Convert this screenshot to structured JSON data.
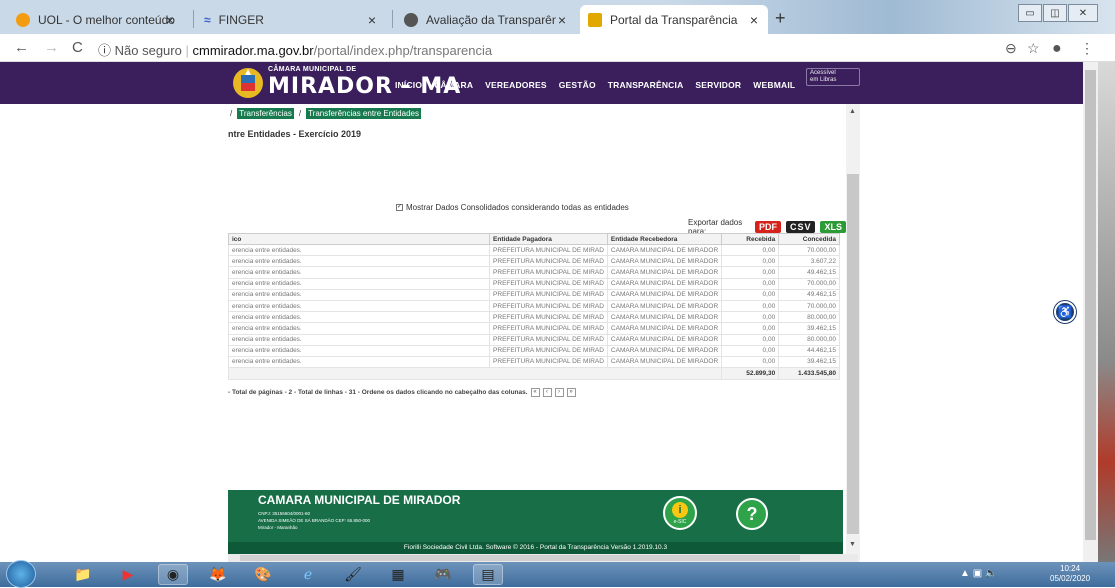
{
  "browser": {
    "tabs": [
      {
        "label": "UOL - O melhor conteúdo",
        "icon_color": "#f39c12"
      },
      {
        "label": "FINGER",
        "icon_color": "#3a5fcd"
      },
      {
        "label": "Avaliação da Transparência dos",
        "icon_color": "#555555"
      },
      {
        "label": "Portal da Transparência",
        "icon_color": "#e0a800",
        "active": true
      }
    ],
    "url_prefix": "Não seguro",
    "url_domain": "cmmirador.ma.gov.br",
    "url_path": "/portal/index.php/transparencia"
  },
  "site": {
    "logo_small": "CÂMARA MUNICIPAL DE",
    "logo_big": "MIRADOR - MA",
    "menu": [
      "INÍCIO",
      "CÂMARA",
      "VEREADORES",
      "GESTÃO",
      "TRANSPARÊNCIA",
      "SERVIDOR",
      "WEBMAIL"
    ],
    "libras_line1": "Acessível",
    "libras_line2": "em Libras"
  },
  "content": {
    "breadcrumb": [
      "Transferências",
      "Transferências entre Entidades"
    ],
    "title": "ntre Entidades - Exercício 2019",
    "consolidated_label": "Mostrar Dados Consolidados considerando todas as entidades",
    "export_label": "Exportar dados para:",
    "export_pdf": "PDF",
    "export_csv": "CSV",
    "export_xls": "XLS",
    "table": {
      "headers": [
        "ico",
        "Entidade Pagadora",
        "Entidade Recebedora",
        "Recebida",
        "Concedida"
      ],
      "rows": [
        [
          "erencia entre entidades.",
          "PREFEITURA MUNICIPAL DE MIRAD",
          "CAMARA MUNICIPAL DE MIRADOR",
          "0,00",
          "70.000,00"
        ],
        [
          "erencia entre entidades.",
          "PREFEITURA MUNICIPAL DE MIRAD",
          "CAMARA MUNICIPAL DE MIRADOR",
          "0,00",
          "3.607,22"
        ],
        [
          "erencia entre entidades.",
          "PREFEITURA MUNICIPAL DE MIRAD",
          "CAMARA MUNICIPAL DE MIRADOR",
          "0,00",
          "49.462,15"
        ],
        [
          "erencia entre entidades.",
          "PREFEITURA MUNICIPAL DE MIRAD",
          "CAMARA MUNICIPAL DE MIRADOR",
          "0,00",
          "70.000,00"
        ],
        [
          "erencia entre entidades.",
          "PREFEITURA MUNICIPAL DE MIRAD",
          "CAMARA MUNICIPAL DE MIRADOR",
          "0,00",
          "49.462,15"
        ],
        [
          "erencia entre entidades.",
          "PREFEITURA MUNICIPAL DE MIRAD",
          "CAMARA MUNICIPAL DE MIRADOR",
          "0,00",
          "70.000,00"
        ],
        [
          "erencia entre entidades.",
          "PREFEITURA MUNICIPAL DE MIRAD",
          "CAMARA MUNICIPAL DE MIRADOR",
          "0,00",
          "80.000,00"
        ],
        [
          "erencia entre entidades.",
          "PREFEITURA MUNICIPAL DE MIRAD",
          "CAMARA MUNICIPAL DE MIRADOR",
          "0,00",
          "39.462,15"
        ],
        [
          "erencia entre entidades.",
          "PREFEITURA MUNICIPAL DE MIRAD",
          "CAMARA MUNICIPAL DE MIRADOR",
          "0,00",
          "80.000,00"
        ],
        [
          "erencia entre entidades.",
          "PREFEITURA MUNICIPAL DE MIRAD",
          "CAMARA MUNICIPAL DE MIRADOR",
          "0,00",
          "44.462,15"
        ],
        [
          "erencia entre entidades.",
          "PREFEITURA MUNICIPAL DE MIRAD",
          "CAMARA MUNICIPAL DE MIRADOR",
          "0,00",
          "39.462,15"
        ]
      ],
      "total_recebida": "52.899,30",
      "total_concedida": "1.433.545,80"
    },
    "pager_text": "- Total de páginas - 2 - Total de linhas - 31 - Ordene os dados clicando no cabeçalho das colunas."
  },
  "footer": {
    "name": "CAMARA MUNICIPAL DE MIRADOR",
    "cnpj": "CNPJ: 35156604/0001-60",
    "address": "AVENIDA SIMEÃO DE SÁ BRANDÃO CEP: 65.850-000",
    "city": "Mirador - Maranhão",
    "esic_label": "e-SIC",
    "copyright": "Fiorilli Sociedade Civil Ltda. Software © 2016 - Portal da Transparência Versão 1.2019.10.3"
  },
  "taskbar": {
    "time": "10:24",
    "date": "05/02/2020"
  }
}
